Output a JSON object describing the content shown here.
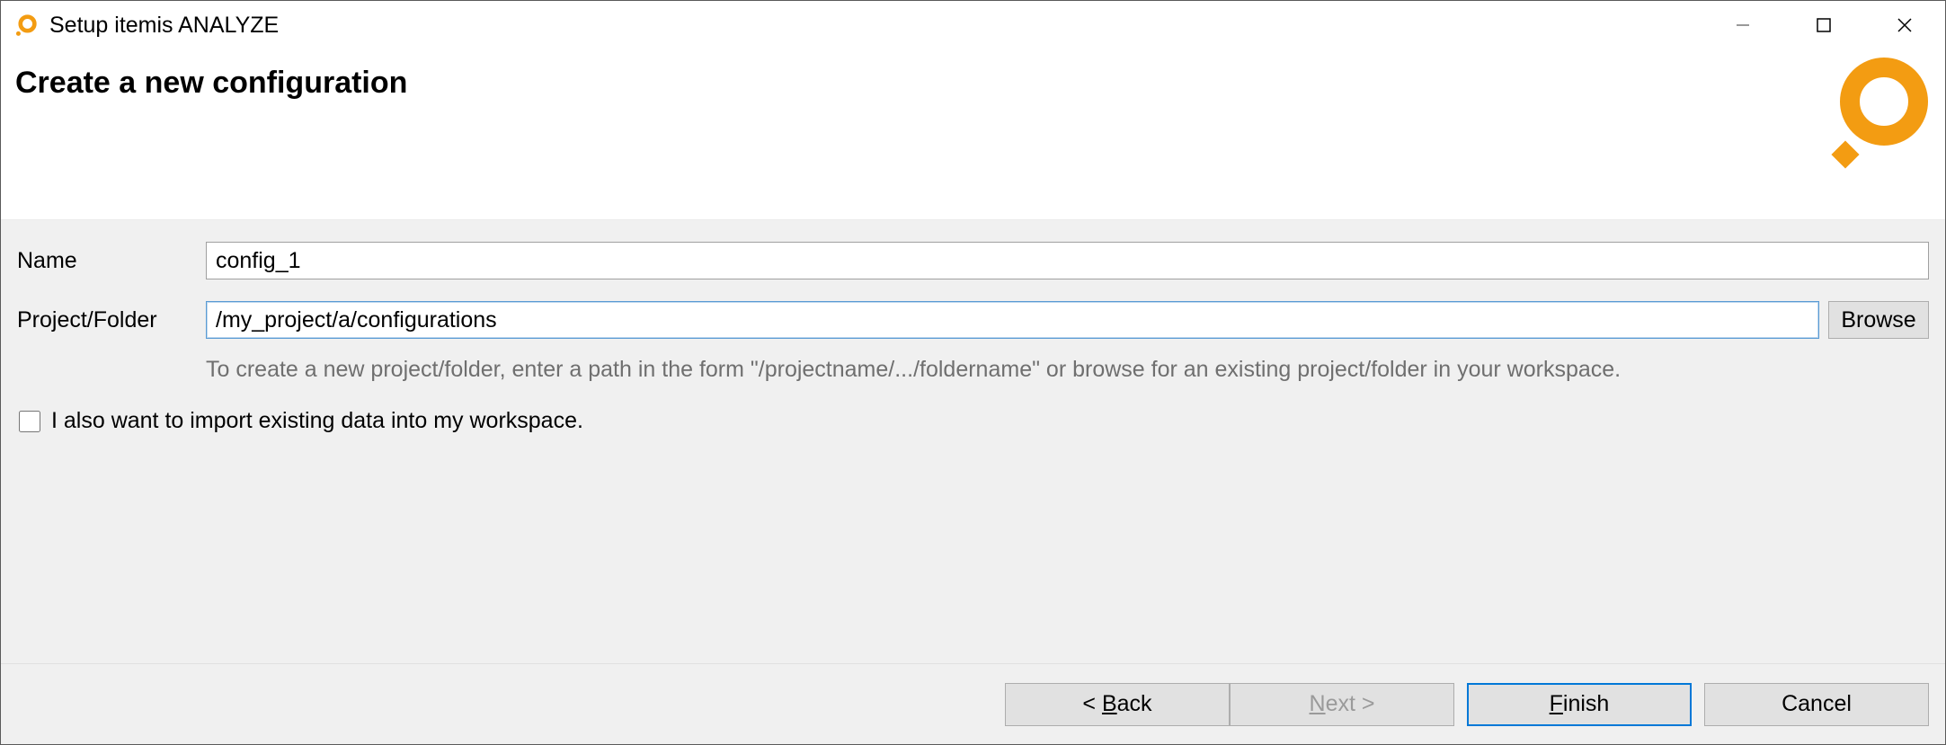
{
  "titlebar": {
    "title": "Setup itemis ANALYZE"
  },
  "banner": {
    "heading": "Create a new configuration"
  },
  "form": {
    "name_label": "Name",
    "name_value": "config_1",
    "folder_label": "Project/Folder",
    "folder_value": "/my_project/a/configurations",
    "browse_label": "Browse",
    "folder_help": "To create a new project/folder, enter a path in the form \"/projectname/.../foldername\" or browse for an existing project/folder in your workspace.",
    "import_checkbox_label": "I also want to import existing data into my workspace.",
    "import_checked": false
  },
  "footer": {
    "back": "< Back",
    "next": "Next >",
    "finish": "Finish",
    "cancel": "Cancel",
    "next_enabled": false
  },
  "colors": {
    "accent": "#f39c12",
    "focus": "#5a9bd4",
    "primary_border": "#0078d7"
  }
}
